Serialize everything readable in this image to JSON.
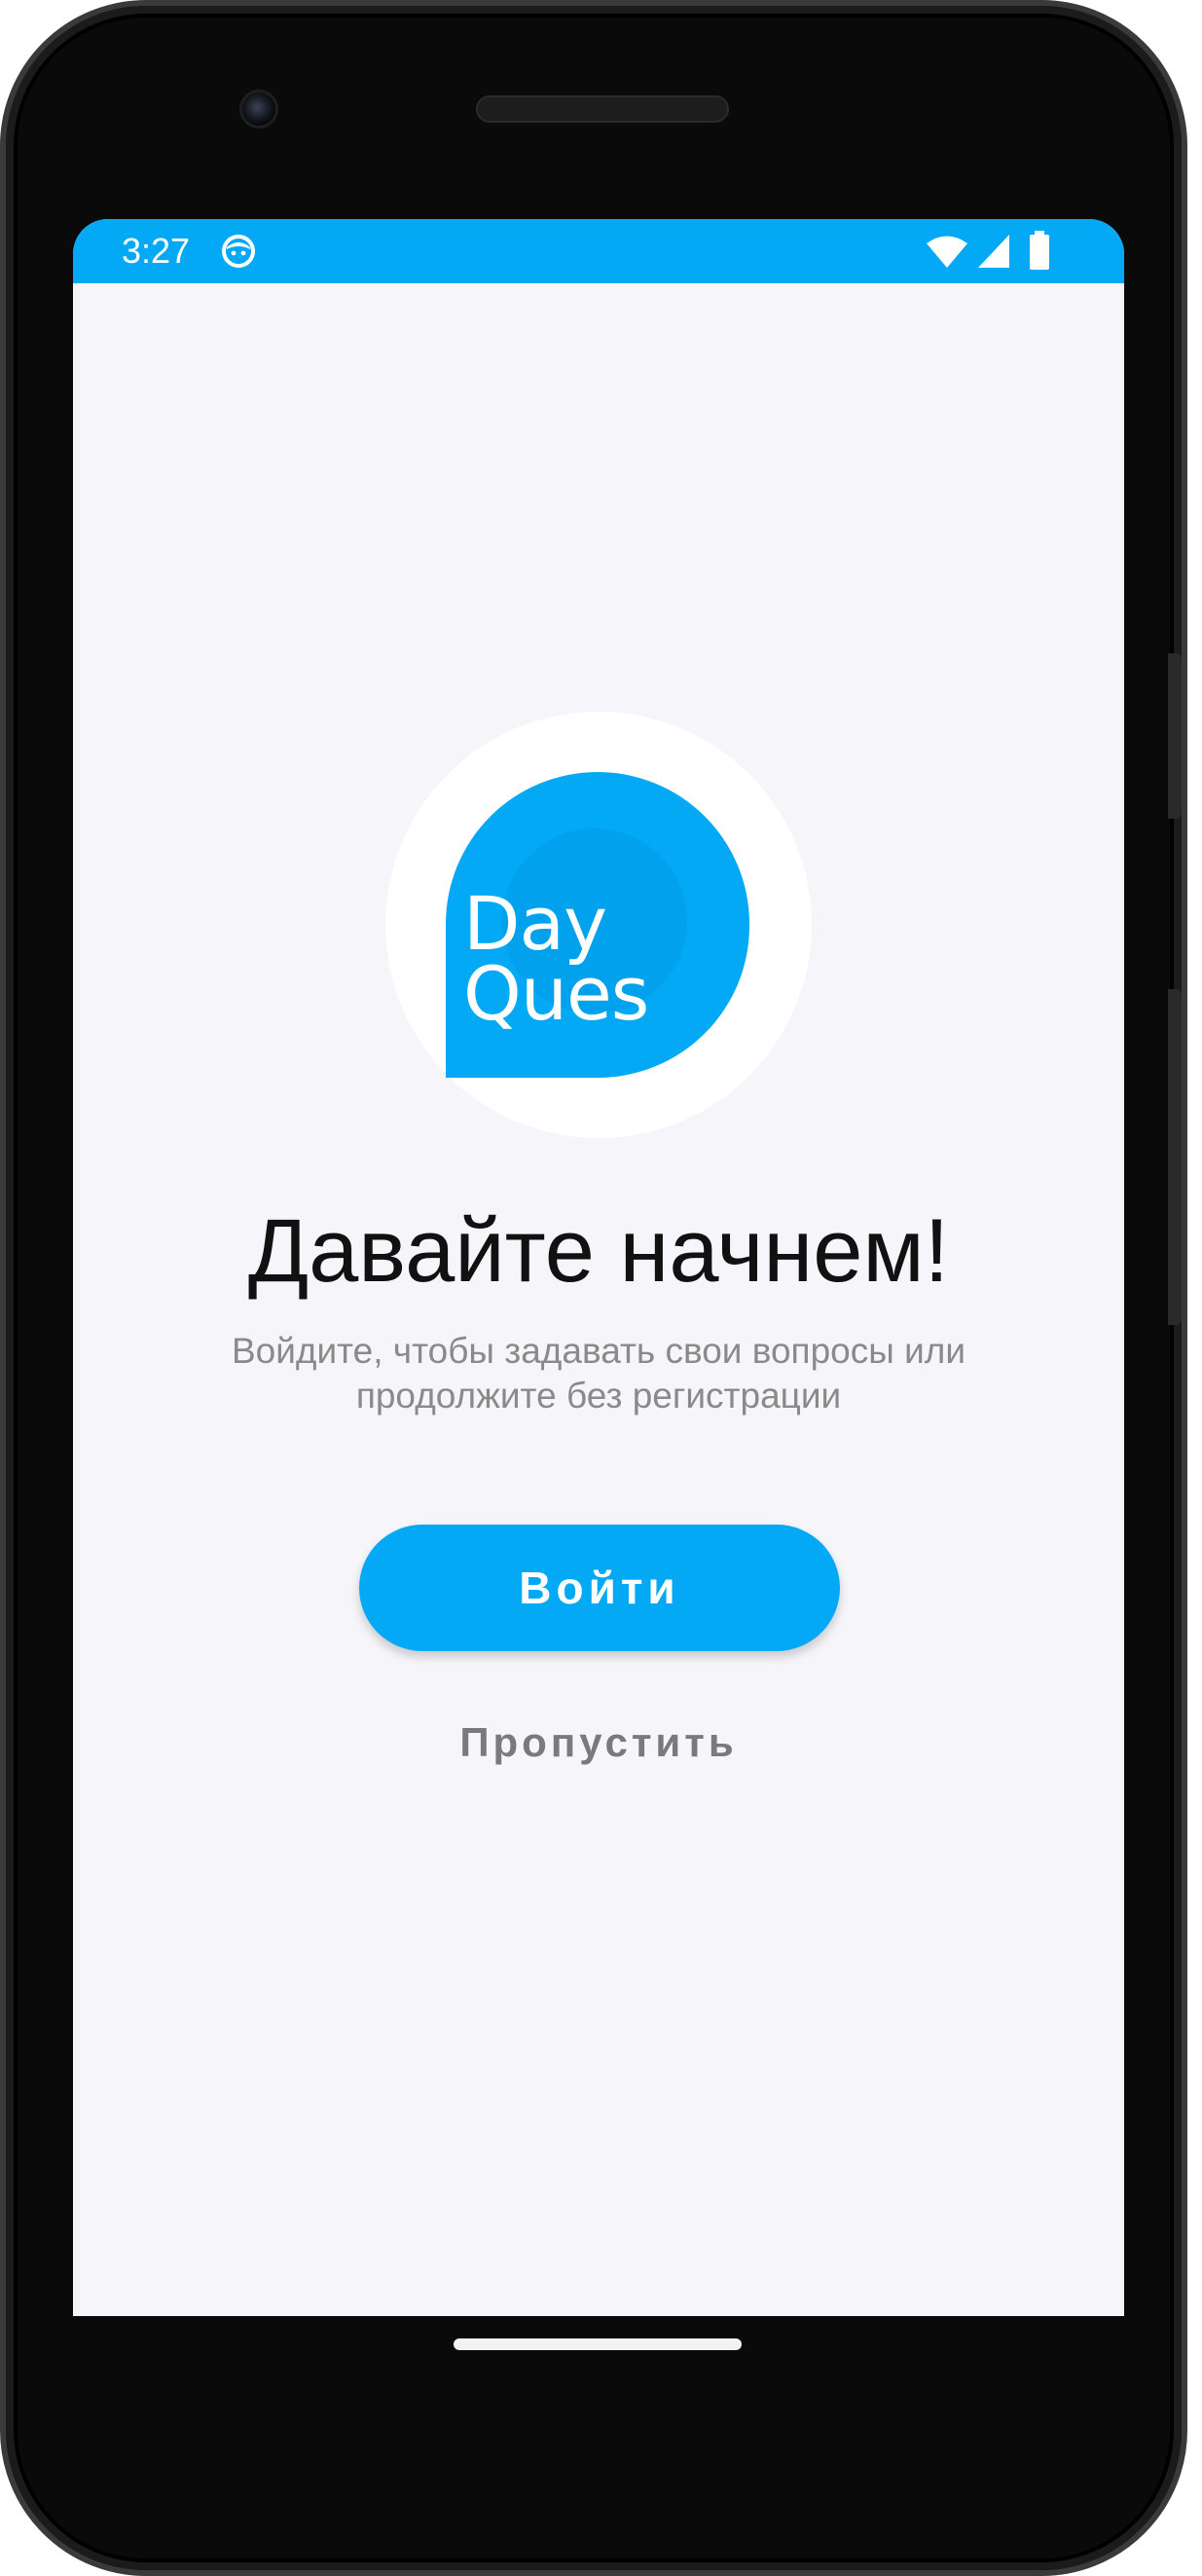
{
  "status_bar": {
    "time": "3:27",
    "background_color": "#03a9f4",
    "icons": [
      "notification-face-icon",
      "wifi-icon",
      "cellular-signal-icon",
      "battery-icon"
    ]
  },
  "logo": {
    "line1": "Day",
    "line2": "Ques",
    "brand_color": "#03a9f4"
  },
  "welcome": {
    "title": "Давайте начнем!",
    "subtitle": "Войдите, чтобы задавать свои вопросы или продолжите без регистрации"
  },
  "actions": {
    "login_label": "Войти",
    "skip_label": "Пропустить"
  },
  "colors": {
    "accent": "#03a9f4",
    "background": "#f6f6fa",
    "secondary_text": "#8a8a8a"
  }
}
